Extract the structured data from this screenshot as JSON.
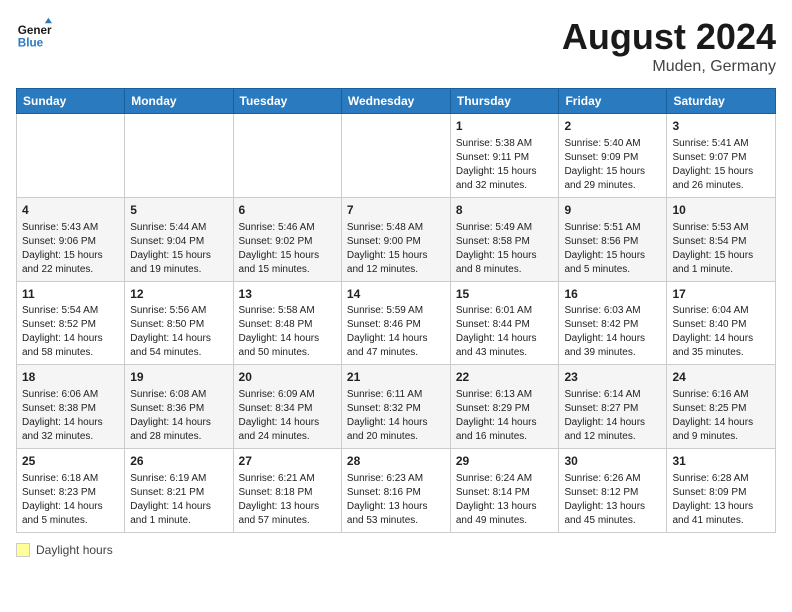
{
  "logo": {
    "text_general": "General",
    "text_blue": "Blue"
  },
  "title": {
    "month_year": "August 2024",
    "location": "Muden, Germany"
  },
  "days_of_week": [
    "Sunday",
    "Monday",
    "Tuesday",
    "Wednesday",
    "Thursday",
    "Friday",
    "Saturday"
  ],
  "weeks": [
    [
      {
        "day": "",
        "info": ""
      },
      {
        "day": "",
        "info": ""
      },
      {
        "day": "",
        "info": ""
      },
      {
        "day": "",
        "info": ""
      },
      {
        "day": "1",
        "info": "Sunrise: 5:38 AM\nSunset: 9:11 PM\nDaylight: 15 hours and 32 minutes."
      },
      {
        "day": "2",
        "info": "Sunrise: 5:40 AM\nSunset: 9:09 PM\nDaylight: 15 hours and 29 minutes."
      },
      {
        "day": "3",
        "info": "Sunrise: 5:41 AM\nSunset: 9:07 PM\nDaylight: 15 hours and 26 minutes."
      }
    ],
    [
      {
        "day": "4",
        "info": "Sunrise: 5:43 AM\nSunset: 9:06 PM\nDaylight: 15 hours and 22 minutes."
      },
      {
        "day": "5",
        "info": "Sunrise: 5:44 AM\nSunset: 9:04 PM\nDaylight: 15 hours and 19 minutes."
      },
      {
        "day": "6",
        "info": "Sunrise: 5:46 AM\nSunset: 9:02 PM\nDaylight: 15 hours and 15 minutes."
      },
      {
        "day": "7",
        "info": "Sunrise: 5:48 AM\nSunset: 9:00 PM\nDaylight: 15 hours and 12 minutes."
      },
      {
        "day": "8",
        "info": "Sunrise: 5:49 AM\nSunset: 8:58 PM\nDaylight: 15 hours and 8 minutes."
      },
      {
        "day": "9",
        "info": "Sunrise: 5:51 AM\nSunset: 8:56 PM\nDaylight: 15 hours and 5 minutes."
      },
      {
        "day": "10",
        "info": "Sunrise: 5:53 AM\nSunset: 8:54 PM\nDaylight: 15 hours and 1 minute."
      }
    ],
    [
      {
        "day": "11",
        "info": "Sunrise: 5:54 AM\nSunset: 8:52 PM\nDaylight: 14 hours and 58 minutes."
      },
      {
        "day": "12",
        "info": "Sunrise: 5:56 AM\nSunset: 8:50 PM\nDaylight: 14 hours and 54 minutes."
      },
      {
        "day": "13",
        "info": "Sunrise: 5:58 AM\nSunset: 8:48 PM\nDaylight: 14 hours and 50 minutes."
      },
      {
        "day": "14",
        "info": "Sunrise: 5:59 AM\nSunset: 8:46 PM\nDaylight: 14 hours and 47 minutes."
      },
      {
        "day": "15",
        "info": "Sunrise: 6:01 AM\nSunset: 8:44 PM\nDaylight: 14 hours and 43 minutes."
      },
      {
        "day": "16",
        "info": "Sunrise: 6:03 AM\nSunset: 8:42 PM\nDaylight: 14 hours and 39 minutes."
      },
      {
        "day": "17",
        "info": "Sunrise: 6:04 AM\nSunset: 8:40 PM\nDaylight: 14 hours and 35 minutes."
      }
    ],
    [
      {
        "day": "18",
        "info": "Sunrise: 6:06 AM\nSunset: 8:38 PM\nDaylight: 14 hours and 32 minutes."
      },
      {
        "day": "19",
        "info": "Sunrise: 6:08 AM\nSunset: 8:36 PM\nDaylight: 14 hours and 28 minutes."
      },
      {
        "day": "20",
        "info": "Sunrise: 6:09 AM\nSunset: 8:34 PM\nDaylight: 14 hours and 24 minutes."
      },
      {
        "day": "21",
        "info": "Sunrise: 6:11 AM\nSunset: 8:32 PM\nDaylight: 14 hours and 20 minutes."
      },
      {
        "day": "22",
        "info": "Sunrise: 6:13 AM\nSunset: 8:29 PM\nDaylight: 14 hours and 16 minutes."
      },
      {
        "day": "23",
        "info": "Sunrise: 6:14 AM\nSunset: 8:27 PM\nDaylight: 14 hours and 12 minutes."
      },
      {
        "day": "24",
        "info": "Sunrise: 6:16 AM\nSunset: 8:25 PM\nDaylight: 14 hours and 9 minutes."
      }
    ],
    [
      {
        "day": "25",
        "info": "Sunrise: 6:18 AM\nSunset: 8:23 PM\nDaylight: 14 hours and 5 minutes."
      },
      {
        "day": "26",
        "info": "Sunrise: 6:19 AM\nSunset: 8:21 PM\nDaylight: 14 hours and 1 minute."
      },
      {
        "day": "27",
        "info": "Sunrise: 6:21 AM\nSunset: 8:18 PM\nDaylight: 13 hours and 57 minutes."
      },
      {
        "day": "28",
        "info": "Sunrise: 6:23 AM\nSunset: 8:16 PM\nDaylight: 13 hours and 53 minutes."
      },
      {
        "day": "29",
        "info": "Sunrise: 6:24 AM\nSunset: 8:14 PM\nDaylight: 13 hours and 49 minutes."
      },
      {
        "day": "30",
        "info": "Sunrise: 6:26 AM\nSunset: 8:12 PM\nDaylight: 13 hours and 45 minutes."
      },
      {
        "day": "31",
        "info": "Sunrise: 6:28 AM\nSunset: 8:09 PM\nDaylight: 13 hours and 41 minutes."
      }
    ]
  ],
  "legend": {
    "label": "Daylight hours"
  }
}
